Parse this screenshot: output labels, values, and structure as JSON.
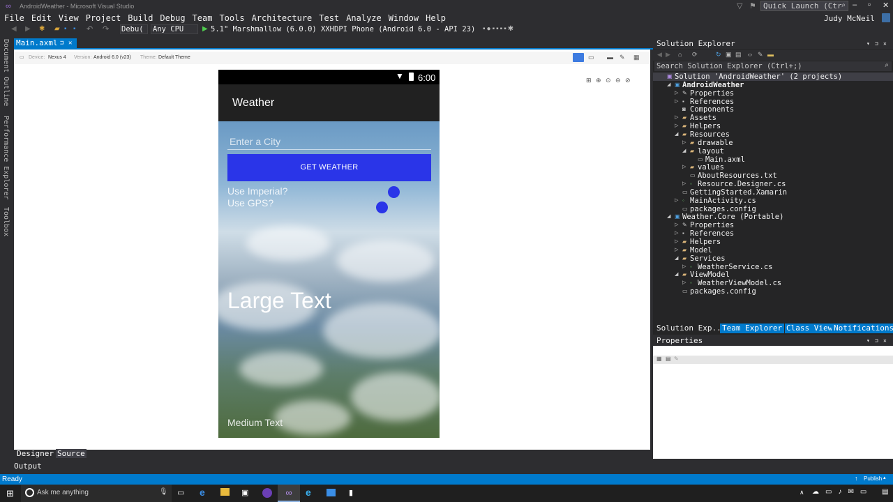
{
  "window": {
    "title": "AndroidWeather - Microsoft Visual Studio"
  },
  "menu": [
    "File",
    "Edit",
    "View",
    "Project",
    "Build",
    "Debug",
    "Team",
    "Tools",
    "Architecture",
    "Test",
    "Analyze",
    "Window",
    "Help"
  ],
  "quick_launch": {
    "placeholder": "Quick Launch (Ctr"
  },
  "user": {
    "name": "Judy McNeil"
  },
  "toolbar": {
    "config": "Debu(",
    "platform": "Any CPU",
    "device": "5.1\" Marshmallow (6.0.0) XXHDPI Phone (Android 6.0 - API 23)"
  },
  "left_tabs": [
    "Document Outline",
    "Performance Explorer",
    "Toolbox"
  ],
  "doc_tab": {
    "label": "Main.axml"
  },
  "designer_toolbar": {
    "device_label": "Device:",
    "device_value": "Nexus 4",
    "version_label": "Version:",
    "version_value": "Android 6.0 (v23)",
    "theme_label": "Theme:",
    "theme_value": "Default Theme"
  },
  "phone": {
    "time": "6:00",
    "app_title": "Weather",
    "city_placeholder": "Enter a City",
    "button": "GET WEATHER",
    "imperial": "Use Imperial?",
    "gps": "Use GPS?",
    "large_text": "Large Text",
    "medium_text": "Medium Text"
  },
  "solution_explorer": {
    "title": "Solution Explorer",
    "search_placeholder": "Search Solution Explorer (Ctrl+;)",
    "items": [
      {
        "label": "Solution 'AndroidWeather' (2 projects)",
        "level": 0,
        "arrow": "",
        "icon": "solution-icon"
      },
      {
        "label": "AndroidWeather",
        "level": 1,
        "arrow": "▲",
        "icon": "project-icon",
        "bold": true
      },
      {
        "label": "Properties",
        "level": 2,
        "arrow": "▷",
        "icon": "wrench-icon"
      },
      {
        "label": "References",
        "level": 2,
        "arrow": "▷",
        "icon": "references-icon"
      },
      {
        "label": "Components",
        "level": 2,
        "arrow": "",
        "icon": "components-icon"
      },
      {
        "label": "Assets",
        "level": 2,
        "arrow": "▷",
        "icon": "folder-icon"
      },
      {
        "label": "Helpers",
        "level": 2,
        "arrow": "▷",
        "icon": "folder-icon"
      },
      {
        "label": "Resources",
        "level": 2,
        "arrow": "▲",
        "icon": "folder-icon"
      },
      {
        "label": "drawable",
        "level": 3,
        "arrow": "▷",
        "icon": "folder-icon"
      },
      {
        "label": "layout",
        "level": 3,
        "arrow": "▲",
        "icon": "folder-icon"
      },
      {
        "label": "Main.axml",
        "level": 4,
        "arrow": "",
        "icon": "file-icon"
      },
      {
        "label": "values",
        "level": 3,
        "arrow": "▷",
        "icon": "folder-icon"
      },
      {
        "label": "AboutResources.txt",
        "level": 3,
        "arrow": "",
        "icon": "file-icon"
      },
      {
        "label": "Resource.Designer.cs",
        "level": 3,
        "arrow": "▷",
        "icon": "csharp-icon"
      },
      {
        "label": "GettingStarted.Xamarin",
        "level": 2,
        "arrow": "",
        "icon": "file-icon"
      },
      {
        "label": "MainActivity.cs",
        "level": 2,
        "arrow": "▷",
        "icon": "csharp-icon"
      },
      {
        "label": "packages.config",
        "level": 2,
        "arrow": "",
        "icon": "config-icon"
      },
      {
        "label": "Weather.Core (Portable)",
        "level": 1,
        "arrow": "▲",
        "icon": "project-icon"
      },
      {
        "label": "Properties",
        "level": 2,
        "arrow": "▷",
        "icon": "wrench-icon"
      },
      {
        "label": "References",
        "level": 2,
        "arrow": "▷",
        "icon": "references-icon"
      },
      {
        "label": "Helpers",
        "level": 2,
        "arrow": "▷",
        "icon": "folder-icon"
      },
      {
        "label": "Model",
        "level": 2,
        "arrow": "▷",
        "icon": "folder-icon"
      },
      {
        "label": "Services",
        "level": 2,
        "arrow": "▲",
        "icon": "folder-icon"
      },
      {
        "label": "WeatherService.cs",
        "level": 3,
        "arrow": "▷",
        "icon": "csharp-icon"
      },
      {
        "label": "ViewModel",
        "level": 2,
        "arrow": "▲",
        "icon": "folder-icon"
      },
      {
        "label": "WeatherViewModel.cs",
        "level": 3,
        "arrow": "▷",
        "icon": "csharp-icon"
      },
      {
        "label": "packages.config",
        "level": 2,
        "arrow": "",
        "icon": "config-icon"
      }
    ],
    "tabs": [
      "Solution Exp...",
      "Team Explorer",
      "Class View",
      "Notifications"
    ]
  },
  "properties": {
    "title": "Properties"
  },
  "bottom": {
    "designer_tab": "Designer",
    "source_tab": "Source",
    "output": "Output"
  },
  "status": {
    "text": "Ready",
    "publish": "Publish"
  },
  "taskbar": {
    "search_placeholder": "Ask me anything"
  },
  "colors": {
    "accent": "#007acc",
    "button": "#2a35e8",
    "panel": "#252526",
    "chrome": "#2d2d30"
  }
}
